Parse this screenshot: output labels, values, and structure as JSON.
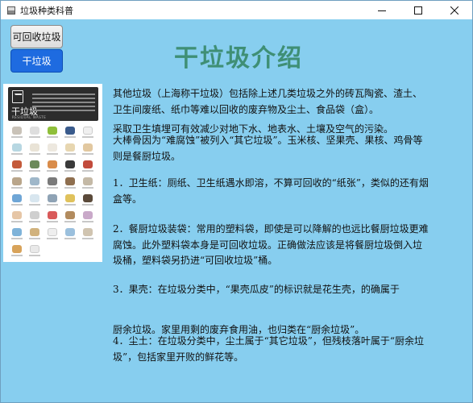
{
  "window": {
    "title": "垃圾种类科普",
    "controls": {
      "minimize": "—",
      "maximize": "☐",
      "close": "✕"
    }
  },
  "buttons": {
    "recyclable": "可回收垃圾",
    "dry": "干垃圾"
  },
  "page_title": "干垃圾介绍",
  "poster": {
    "name": "干垃圾",
    "subtitle": "RESIDUAL WASTE"
  },
  "paragraphs": {
    "p1": "其他垃圾（上海称干垃圾）包括除上述几类垃圾之外的砖瓦陶瓷、渣土、卫生间废纸、纸巾等难以回收的废弃物及尘土、食品袋（盒）。",
    "p2": "采取卫生填埋可有效减少对地下水、地表水、土壤及空气的污染。",
    "p3": "大棒骨因为“难腐蚀”被列入“其它垃圾”。玉米核、坚果壳、果核、鸡骨等则是餐厨垃圾。",
    "p4": "1．卫生纸：厕纸、卫生纸遇水即溶，不算可回收的“纸张”，类似的还有烟盒等。",
    "p5": "2．餐厨垃圾装袋：常用的塑料袋，即使是可以降解的也远比餐厨垃圾更难腐蚀。此外塑料袋本身是可回收垃圾。正确做法应该是将餐厨垃圾倒入垃圾桶，塑料袋另扔进“可回收垃圾”桶。",
    "p6": "3．果壳：在垃圾分类中，“果壳瓜皮”的标识就是花生壳，的确属于",
    "p7": "厨余垃圾。家里用剩的废弃食用油，也归类在“厨余垃圾”。",
    "p8": "4．尘土：在垃圾分类中，尘土属于“其它垃圾”，但残枝落叶属于“厨余垃圾”，包括家里开败的鲜花等。"
  },
  "colors": {
    "background": "#87ceef",
    "title_green": "#3f8f75",
    "active_button": "#1e6be0"
  }
}
